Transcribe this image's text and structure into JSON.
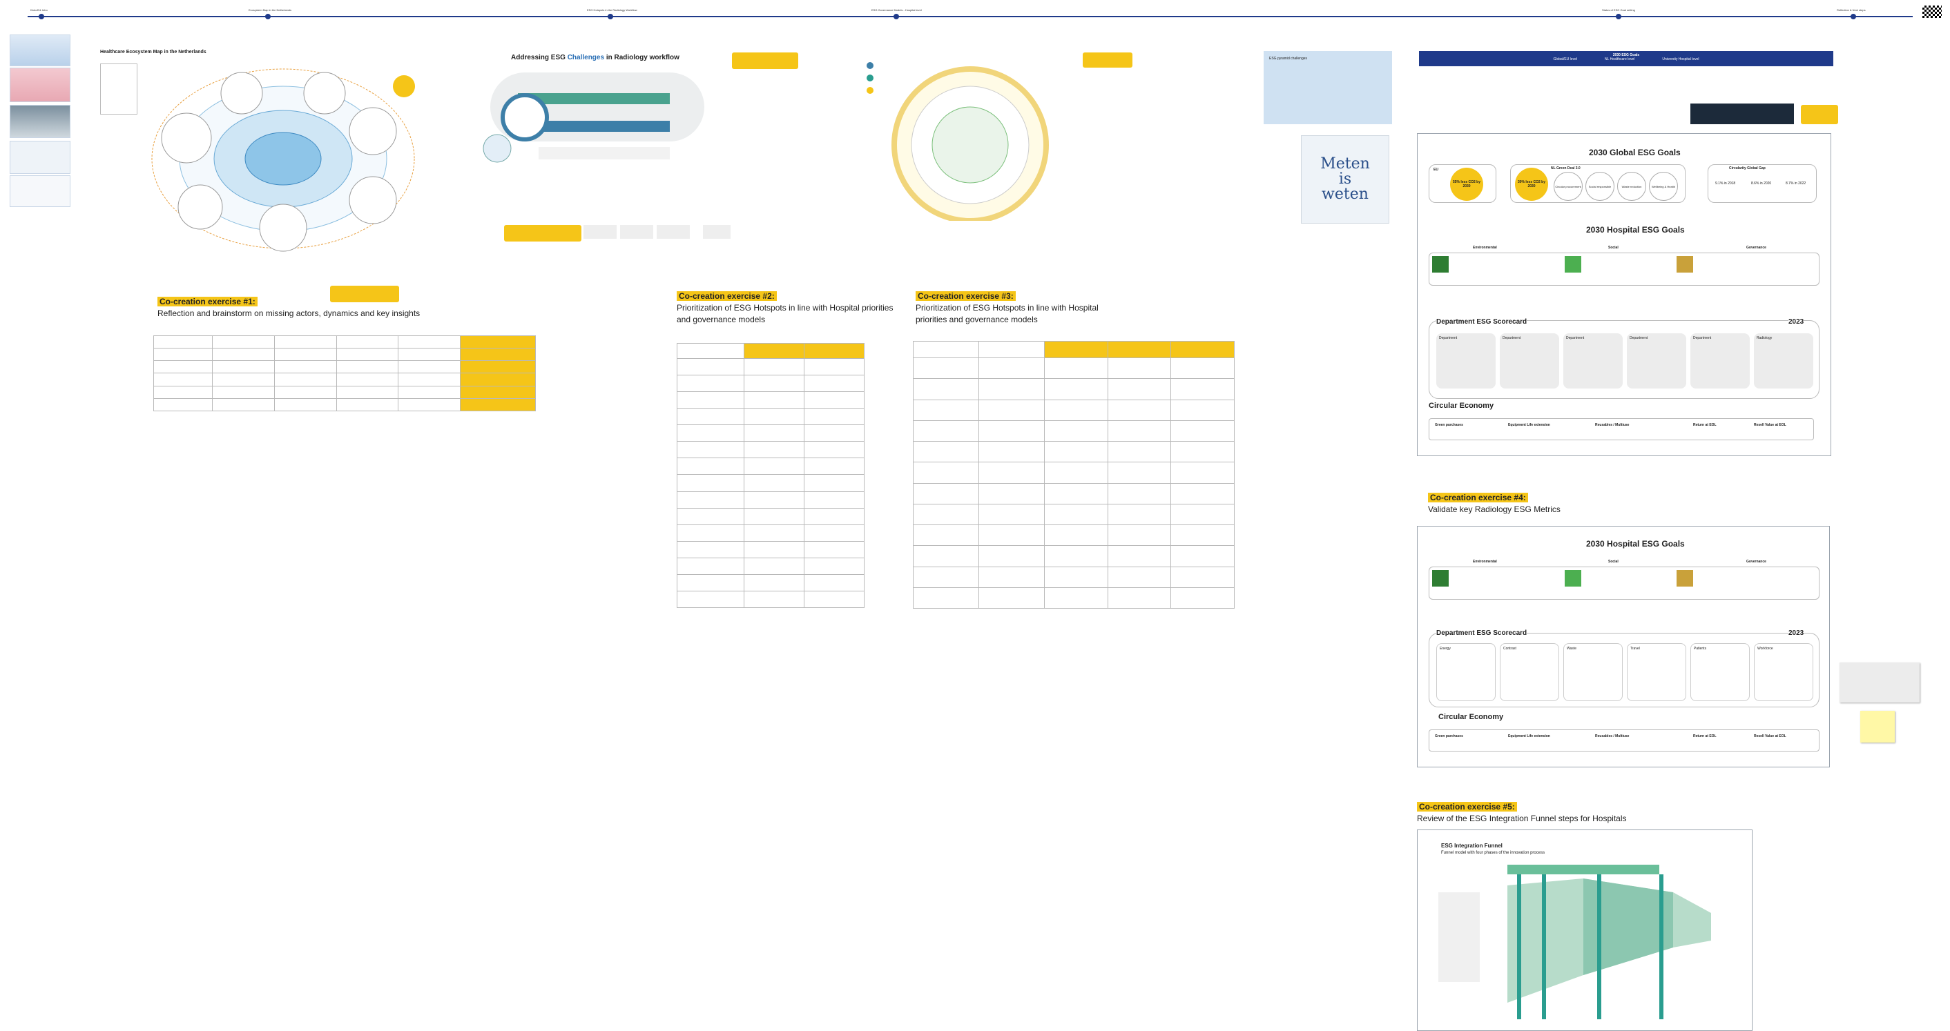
{
  "timeline": {
    "milestones": [
      {
        "label": "Kickoff & Intro"
      },
      {
        "label": "Ecosystem Map in the Netherlands"
      },
      {
        "label": "ESG Hotspots in the Radiology Workflow"
      },
      {
        "label": "ESG Governance Models - Hospital level"
      },
      {
        "label": "Status of ESG Goal setting"
      },
      {
        "label": "Reflection & Next steps"
      }
    ]
  },
  "ecosystem_map": {
    "title": "Healthcare Ecosystem Map in the Netherlands"
  },
  "challenges": {
    "title_prefix": "Addressing ESG ",
    "title_highlight": "Challenges",
    "title_suffix": " in Radiology workflow"
  },
  "pyramid": {
    "title": "ESG pyramid challenges"
  },
  "poster": {
    "line1": "Meten",
    "line2": "is",
    "line3": "weten"
  },
  "goals_banner": {
    "title": "2030 ESG Goals",
    "items": [
      "Global/EU level",
      "NL Healthcare level",
      "University Hospital level"
    ]
  },
  "exercise1": {
    "label": "Co-creation exercise #1:",
    "subtitle": "Reflection and brainstorm on missing actors, dynamics and key insights"
  },
  "exercise2": {
    "label": "Co-creation exercise #2:",
    "subtitle_1": "Prioritization of ESG Hotspots in line with Hospital priorities",
    "subtitle_2": "and governance models"
  },
  "exercise3": {
    "label": "Co-creation exercise #3:",
    "subtitle_1": "Prioritization of ESG Hotspots in line with Hospital",
    "subtitle_2": "priorities and governance models"
  },
  "exercise4": {
    "label": "Co-creation exercise #4:",
    "subtitle": "Validate key Radiology ESG Metrics"
  },
  "exercise5": {
    "label": "Co-creation exercise #5:",
    "subtitle": "Review of the ESG Integration Funnel steps for Hospitals"
  },
  "panel1": {
    "global_title": "2030 Global ESG Goals",
    "eu": "EU",
    "eu_goal": "55% less CO2 by 2030",
    "nl": "NL Green Deal 3.0",
    "nl_goal": "30% less CO2 by 2030",
    "nl_items": [
      "Circular procurement",
      "Social responsible",
      "Waste reduction",
      "Wellbeing & Health"
    ],
    "circ": "Circularity Global Gap",
    "circ_items": [
      "9.1% in 2018",
      "8.6% in 2020",
      "8.7% in 2022"
    ],
    "hospital_title": "2030 Hospital ESG Goals",
    "env": "Environmental",
    "soc": "Social",
    "gov": "Governance",
    "scorecard_title": "Department ESG Scorecard",
    "year": "2023",
    "cards": [
      "Department",
      "Department",
      "Department",
      "Department",
      "Department",
      "Radiology"
    ],
    "circular_title": "Circular Economy",
    "circular_items": [
      "Green purchases",
      "Equipment Life extension",
      "Reusables / Multiuse",
      "Return at EOL",
      "Resell Value at EOL"
    ]
  },
  "panel2": {
    "hospital_title": "2030 Hospital ESG Goals",
    "env": "Environmental",
    "soc": "Social",
    "gov": "Governance",
    "scorecard_title": "Department ESG Scorecard",
    "year": "2023",
    "cards": [
      "Energy",
      "Contrast",
      "Waste",
      "Travel",
      "Patients",
      "Workforce"
    ],
    "circular_title": "Circular Economy",
    "circular_items": [
      "Green purchases",
      "Equipment Life extension",
      "Reusables / Multiuse",
      "Return at EOL",
      "Resell Value at EOL"
    ]
  },
  "funnel": {
    "title": "ESG Integration Funnel",
    "subtitle": "Funnel model with four phases of the innovation process"
  },
  "colors": {
    "accent": "#f5c518",
    "navy": "#1f3a8a",
    "teal": "#2a9d8f"
  }
}
